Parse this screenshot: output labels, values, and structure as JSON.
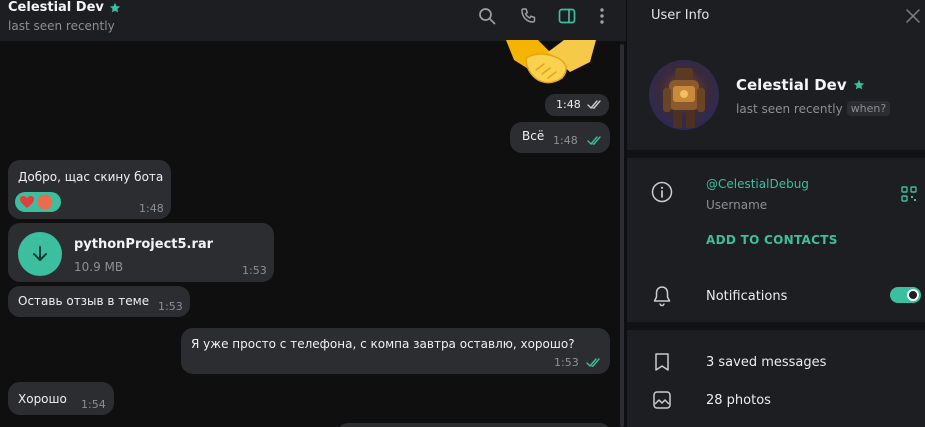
{
  "chat": {
    "title": "Celestial Dev",
    "subtitle": "last seen recently",
    "messages": [
      {
        "time": "1:48"
      },
      {
        "text": "Всё",
        "time": "1:48"
      },
      {
        "text": "Добро, щас скину бота",
        "time": "1:48"
      },
      {
        "file_name": "pythonProject5.rar",
        "file_size": "10.9 MB",
        "time": "1:53"
      },
      {
        "text": "Оставь отзыв в теме",
        "time": "1:53"
      },
      {
        "text": "Я уже просто с телефона, с компа завтра оставлю, хорошо?",
        "time": "1:53"
      },
      {
        "text": "Хорошо",
        "time": "1:54"
      }
    ]
  },
  "info": {
    "title": "User Info",
    "name": "Celestial Dev",
    "status": "last seen recently",
    "when": "when?",
    "username": "@CelestialDebug",
    "username_label": "Username",
    "add_contacts": "ADD TO CONTACTS",
    "notifications": "Notifications",
    "notifications_on": true,
    "saved": "3 saved messages",
    "photos": "28 photos"
  },
  "colors": {
    "accent": "#3bbf9e",
    "bubble": "#2b2d31",
    "panel": "#1c1e22"
  },
  "icons": [
    "star-icon",
    "search-icon",
    "phone-icon",
    "sidebar-toggle-icon",
    "more-icon",
    "close-icon",
    "info-icon",
    "qr-icon",
    "bell-icon",
    "bookmark-icon",
    "photo-icon",
    "download-icon",
    "double-check-icon",
    "heart-icon",
    "tomato-icon",
    "handshake-sticker"
  ]
}
